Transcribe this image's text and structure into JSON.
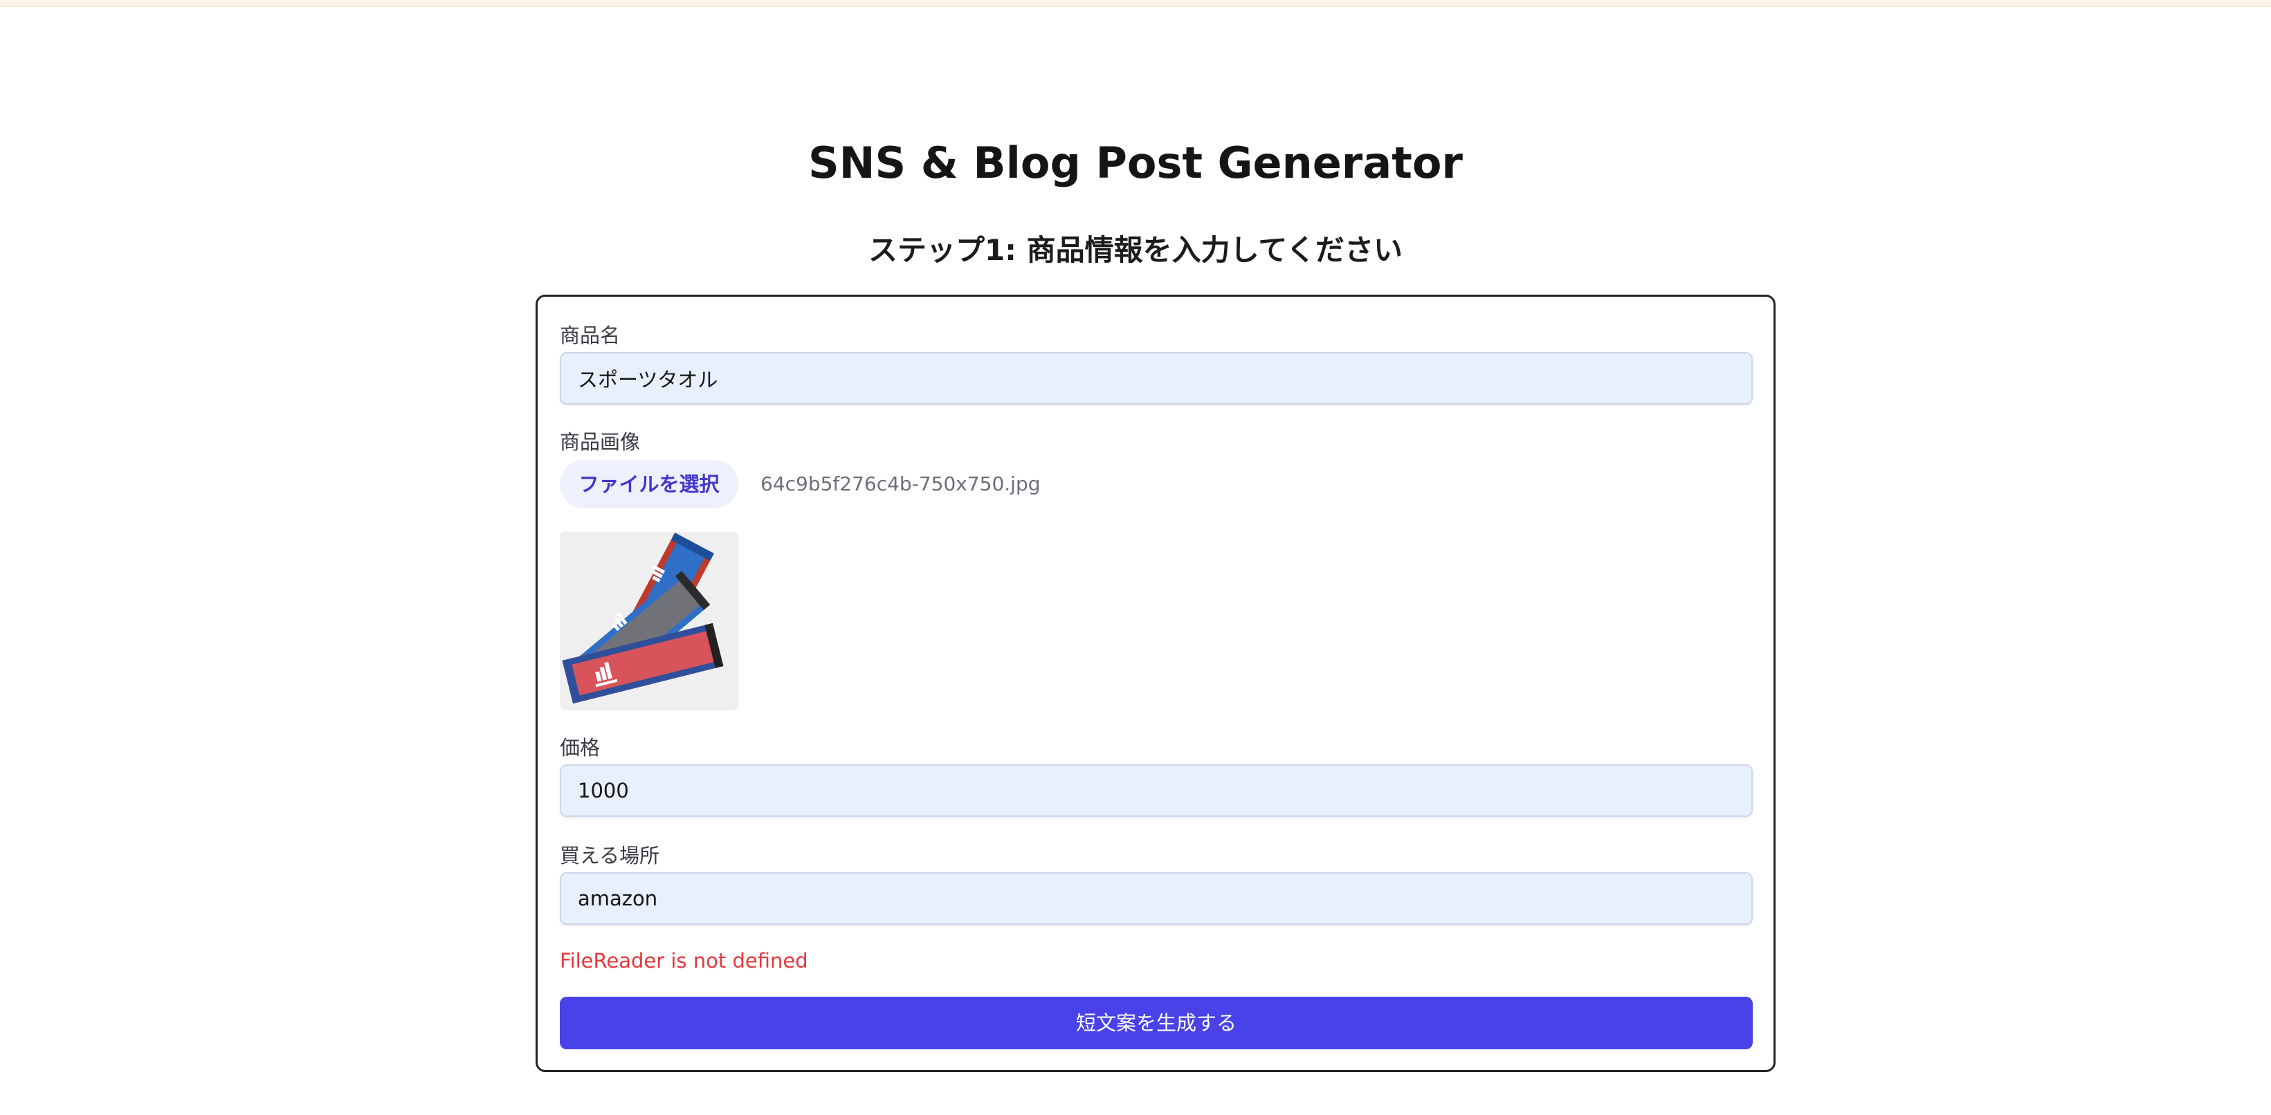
{
  "app": {
    "title": "SNS & Blog Post Generator",
    "step_title": "ステップ1: 商品情報を入力してください"
  },
  "form": {
    "product_name": {
      "label": "商品名",
      "value": "スポーツタオル"
    },
    "product_image": {
      "label": "商品画像",
      "button_label": "ファイルを選択",
      "file_name": "64c9b5f276c4b-750x750.jpg",
      "image_subject": "three folded sports towels in red, gray and blue with a white three-stripe logo"
    },
    "price": {
      "label": "価格",
      "value": "1000"
    },
    "purchase_place": {
      "label": "買える場所",
      "value": "amazon"
    },
    "error_message": "FileReader is not defined",
    "submit_label": "短文案を生成する"
  },
  "colors": {
    "accent": "#4942e9",
    "file_button_text": "#4338ca",
    "file_button_bg": "#eef0fd",
    "input_bg": "#e8effd",
    "error": "#e5383b"
  }
}
